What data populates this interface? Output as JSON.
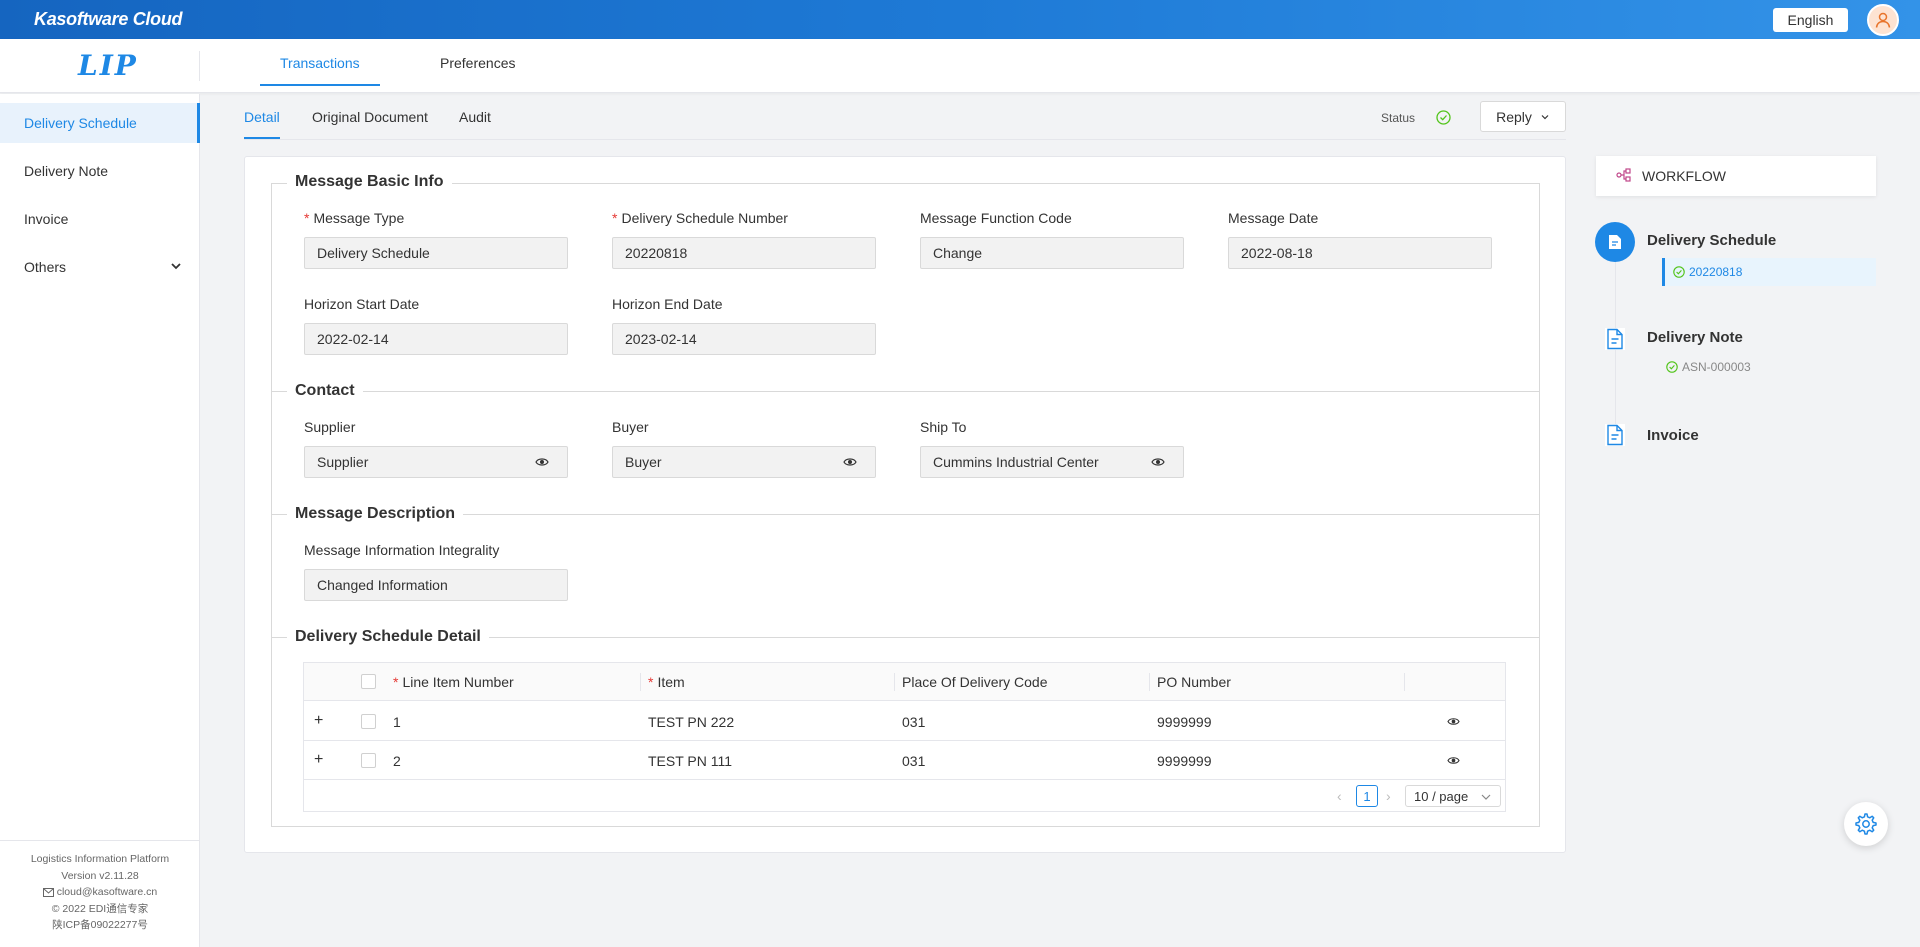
{
  "app": {
    "brand": "Kasoftware Cloud",
    "logo": "LIP",
    "language": "English"
  },
  "nav": {
    "tabs": [
      {
        "label": "Transactions"
      },
      {
        "label": "Preferences"
      }
    ]
  },
  "sidebar": {
    "items": [
      {
        "label": "Delivery Schedule"
      },
      {
        "label": "Delivery Note"
      },
      {
        "label": "Invoice"
      },
      {
        "label": "Others"
      }
    ],
    "footer": {
      "platform": "Logistics Information Platform",
      "version": "Version v2.11.28",
      "email": "cloud@kasoftware.cn",
      "copyright": "© 2022 EDI通信专家",
      "icp": "陕ICP备09022277号"
    }
  },
  "detail_tabs": [
    {
      "label": "Detail"
    },
    {
      "label": "Original Document"
    },
    {
      "label": "Audit"
    }
  ],
  "status": {
    "label": "Status",
    "color": "#52c41a"
  },
  "reply": {
    "label": "Reply"
  },
  "sections": {
    "basic": {
      "title": "Message Basic Info",
      "message_type": {
        "label": "Message Type",
        "value": "Delivery Schedule"
      },
      "ds_number": {
        "label": "Delivery Schedule Number",
        "value": "20220818"
      },
      "function_code": {
        "label": "Message Function Code",
        "value": "Change"
      },
      "message_date": {
        "label": "Message Date",
        "value": "2022-08-18"
      },
      "horizon_start": {
        "label": "Horizon Start Date",
        "value": "2022-02-14"
      },
      "horizon_end": {
        "label": "Horizon End Date",
        "value": "2023-02-14"
      }
    },
    "contact": {
      "title": "Contact",
      "supplier": {
        "label": "Supplier",
        "value": "Supplier"
      },
      "buyer": {
        "label": "Buyer",
        "value": "Buyer"
      },
      "ship_to": {
        "label": "Ship To",
        "value": "Cummins Industrial Center"
      }
    },
    "description": {
      "title": "Message Description",
      "integrality": {
        "label": "Message Information Integrality",
        "value": "Changed Information"
      }
    },
    "detail": {
      "title": "Delivery Schedule Detail",
      "columns": {
        "line_item": "Line Item Number",
        "item": "Item",
        "place": "Place Of Delivery Code",
        "po": "PO Number"
      },
      "rows": [
        {
          "expand": "+",
          "line": "1",
          "item": "TEST PN 222",
          "place": "031",
          "po": "9999999"
        },
        {
          "expand": "+",
          "line": "2",
          "item": "TEST PN 111",
          "place": "031",
          "po": "9999999"
        }
      ],
      "pager": {
        "prev": "‹",
        "current": "1",
        "next": "›",
        "size": "10 / page"
      }
    }
  },
  "workflow": {
    "title": "WORKFLOW",
    "steps": [
      {
        "title": "Delivery Schedule",
        "doc": "20220818"
      },
      {
        "title": "Delivery Note",
        "doc": "ASN-000003"
      },
      {
        "title": "Invoice"
      }
    ]
  },
  "colors": {
    "primary": "#1e88e5",
    "success": "#52c41a",
    "required": "#e53935"
  }
}
